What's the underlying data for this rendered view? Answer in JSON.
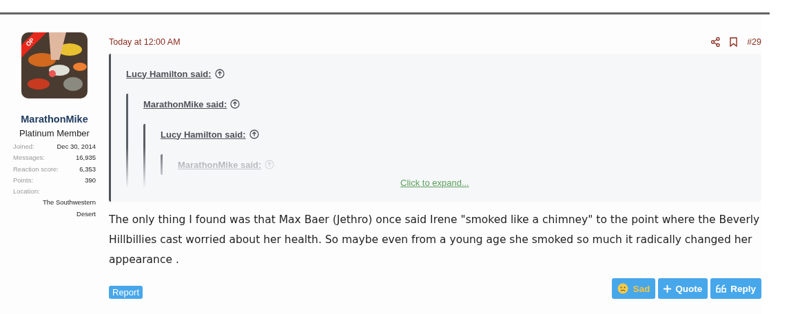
{
  "author": {
    "name": "MarathonMike",
    "title": "Platinum Member",
    "badge": "OP",
    "stats": [
      {
        "label": "Joined:",
        "value": "Dec 30, 2014"
      },
      {
        "label": "Messages:",
        "value": "16,935"
      },
      {
        "label": "Reaction score:",
        "value": "6,353"
      },
      {
        "label": "Points:",
        "value": "390"
      }
    ],
    "location_label": "Location:",
    "location": "The Southwestern Desert"
  },
  "post": {
    "date": "Today at 12:00 AM",
    "number": "#29",
    "quotes": [
      {
        "author": "Lucy Hamilton said:"
      },
      {
        "author": "MarathonMike said:"
      },
      {
        "author": "Lucy Hamilton said:"
      },
      {
        "author": "MarathonMike said:"
      }
    ],
    "expand": "Click to expand...",
    "body": "The only thing I found was that Max Baer (Jethro) once said Irene \"smoked like a chimney\" to the point where the Beverly Hillbillies cast worried about her health. So maybe even from a young age she smoked so much it radically changed her appearance .",
    "report": "Report",
    "actions": [
      {
        "kind": "reaction",
        "label": "Sad",
        "reacted": true
      },
      {
        "kind": "quote",
        "label": "Quote"
      },
      {
        "kind": "reply",
        "label": "Reply"
      }
    ]
  }
}
